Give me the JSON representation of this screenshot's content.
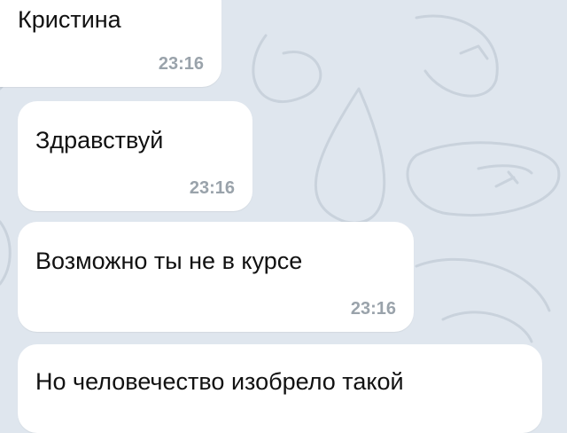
{
  "colors": {
    "background": "#dfe6ee",
    "bubble": "#ffffff",
    "text": "#111111",
    "timestamp": "#9aa3ab"
  },
  "messages": [
    {
      "text": "Кристина",
      "time": "23:16"
    },
    {
      "text": "Здравствуй",
      "time": "23:16"
    },
    {
      "text": "Возможно ты не в курсе",
      "time": "23:16"
    },
    {
      "text": "Но человечество изобрело такой",
      "time": ""
    }
  ]
}
